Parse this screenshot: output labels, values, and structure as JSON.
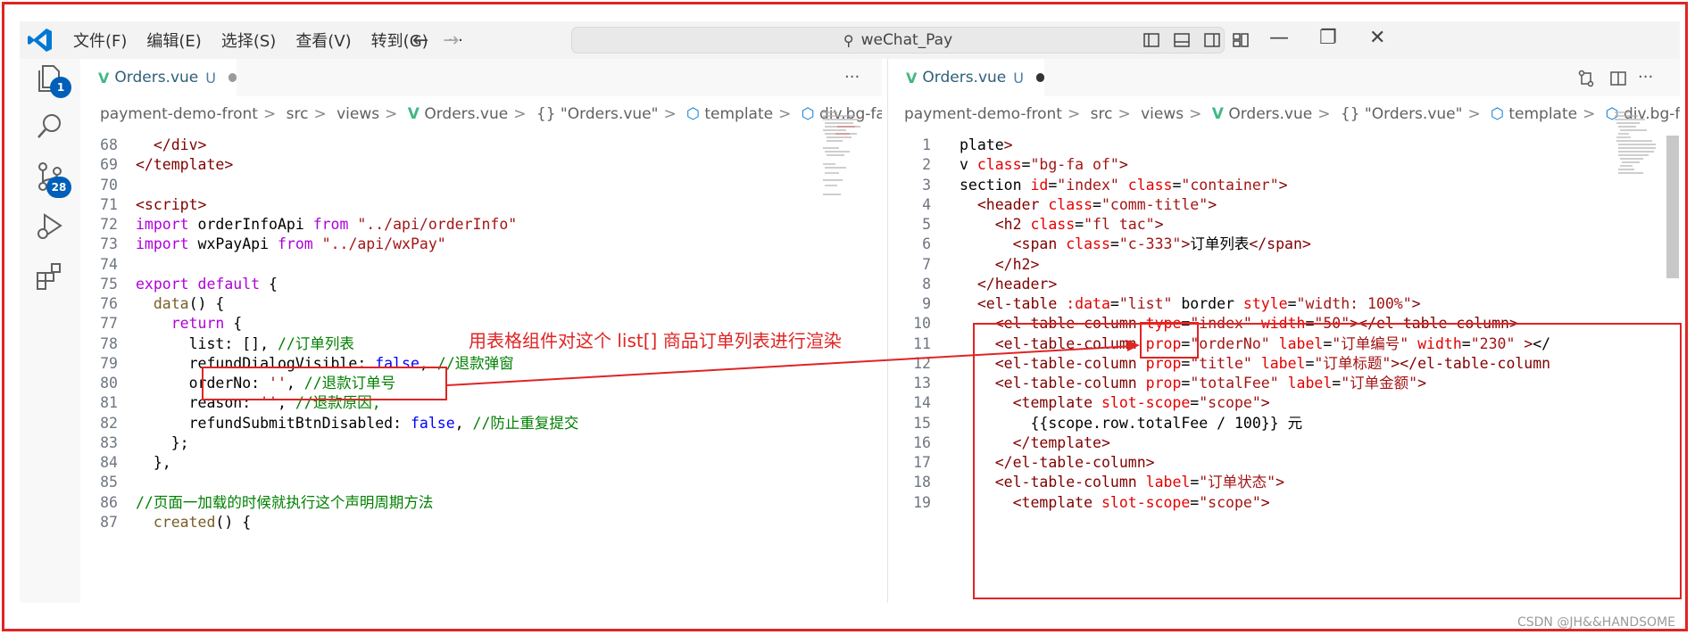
{
  "title_bar": {
    "menus": [
      "文件(F)",
      "编辑(E)",
      "选择(S)",
      "查看(V)",
      "转到(G)",
      "···"
    ],
    "search_text": "weChat_Pay"
  },
  "activity_bar": {
    "items": [
      {
        "icon": "explorer-icon",
        "badge": "1"
      },
      {
        "icon": "search-icon",
        "badge": ""
      },
      {
        "icon": "source-control-icon",
        "badge": "28"
      },
      {
        "icon": "run-debug-icon",
        "badge": ""
      },
      {
        "icon": "extensions-icon",
        "badge": ""
      }
    ]
  },
  "left_editor": {
    "tab": {
      "filename": "Orders.vue",
      "status": "U"
    },
    "breadcrumb": [
      "payment-demo-front",
      "src",
      "views",
      "Orders.vue",
      "{} \"Orders.vue\"",
      "template",
      "div.bg-fa.of"
    ],
    "lines": [
      {
        "num": "68",
        "indent": "  ",
        "text": "</div>"
      },
      {
        "num": "69",
        "indent": "",
        "text": "</template>"
      },
      {
        "num": "70",
        "indent": "",
        "text": ""
      },
      {
        "num": "71",
        "indent": "",
        "text": "<script>"
      },
      {
        "num": "72",
        "indent": "",
        "text": "import orderInfoApi from \"../api/orderInfo\""
      },
      {
        "num": "73",
        "indent": "",
        "text": "import wxPayApi from \"../api/wxPay\""
      },
      {
        "num": "74",
        "indent": "",
        "text": ""
      },
      {
        "num": "75",
        "indent": "",
        "text": "export default {"
      },
      {
        "num": "76",
        "indent": "  ",
        "text": "data() {"
      },
      {
        "num": "77",
        "indent": "    ",
        "text": "return {"
      },
      {
        "num": "78",
        "indent": "      ",
        "text": "list: [], //订单列表"
      },
      {
        "num": "79",
        "indent": "      ",
        "text": "refundDialogVisible: false, //退款弹窗"
      },
      {
        "num": "80",
        "indent": "      ",
        "text": "orderNo: '', //退款订单号"
      },
      {
        "num": "81",
        "indent": "      ",
        "text": "reason: '', //退款原因,"
      },
      {
        "num": "82",
        "indent": "      ",
        "text": "refundSubmitBtnDisabled: false, //防止重复提交"
      },
      {
        "num": "83",
        "indent": "    ",
        "text": "};"
      },
      {
        "num": "84",
        "indent": "  ",
        "text": "},"
      },
      {
        "num": "85",
        "indent": "",
        "text": ""
      },
      {
        "num": "86",
        "indent": "",
        "text": "//页面一加载的时候就执行这个声明周期方法"
      },
      {
        "num": "87",
        "indent": "  ",
        "text": "created() {"
      }
    ]
  },
  "right_editor": {
    "tab": {
      "filename": "Orders.vue",
      "status": "U"
    },
    "breadcrumb": [
      "payment-demo-front",
      "src",
      "views",
      "Orders.vue",
      "{} \"Orders.vue\"",
      "template",
      "div.bg-fa.of"
    ],
    "lines": [
      {
        "num": "1",
        "indent": "",
        "text": "plate>"
      },
      {
        "num": "2",
        "indent": "",
        "text": "v class=\"bg-fa of\">"
      },
      {
        "num": "3",
        "indent": "",
        "text": "section id=\"index\" class=\"container\">"
      },
      {
        "num": "4",
        "indent": "  ",
        "text": "<header class=\"comm-title\">"
      },
      {
        "num": "5",
        "indent": "    ",
        "text": "<h2 class=\"fl tac\">"
      },
      {
        "num": "6",
        "indent": "      ",
        "text": "<span class=\"c-333\">订单列表</span>"
      },
      {
        "num": "7",
        "indent": "    ",
        "text": "</h2>"
      },
      {
        "num": "8",
        "indent": "  ",
        "text": "</header>"
      },
      {
        "num": "9",
        "indent": "  ",
        "text": "<el-table :data=\"list\" border style=\"width: 100%\">"
      },
      {
        "num": "10",
        "indent": "    ",
        "text": "<el-table-column type=\"index\" width=\"50\"></el-table-column>"
      },
      {
        "num": "11",
        "indent": "    ",
        "text": "<el-table-column prop=\"orderNo\" label=\"订单编号\" width=\"230\" ></"
      },
      {
        "num": "12",
        "indent": "    ",
        "text": "<el-table-column prop=\"title\" label=\"订单标题\"></el-table-column"
      },
      {
        "num": "13",
        "indent": "    ",
        "text": "<el-table-column prop=\"totalFee\" label=\"订单金额\">"
      },
      {
        "num": "14",
        "indent": "      ",
        "text": "<template slot-scope=\"scope\">"
      },
      {
        "num": "15",
        "indent": "        ",
        "text": "{{scope.row.totalFee / 100}} 元"
      },
      {
        "num": "16",
        "indent": "      ",
        "text": "</template>"
      },
      {
        "num": "17",
        "indent": "    ",
        "text": "</el-table-column>"
      },
      {
        "num": "18",
        "indent": "    ",
        "text": "<el-table-column label=\"订单状态\">"
      },
      {
        "num": "19",
        "indent": "      ",
        "text": "<template slot-scope=\"scope\">"
      }
    ]
  },
  "annotation": {
    "text": "用表格组件对这个 list[] 商品订单列表进行渲染",
    "color": "#e02424"
  },
  "watermark": "CSDN @JH&&HANDSOME",
  "colors": {
    "accent": "#005fb8",
    "vue_green": "#41b883",
    "annotation_red": "#e02424"
  }
}
